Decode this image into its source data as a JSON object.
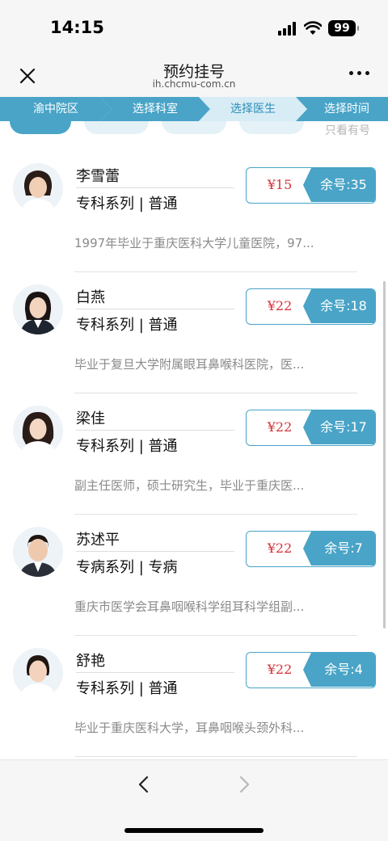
{
  "status_bar": {
    "time": "14:15",
    "battery": "99"
  },
  "header": {
    "title": "预约挂号",
    "url": "ih.chcmu-com.cn"
  },
  "steps": [
    {
      "label": "渝中院区"
    },
    {
      "label": "选择科室"
    },
    {
      "label": "选择医生"
    },
    {
      "label": "选择时间"
    }
  ],
  "filter": {
    "only_available": "只看有号"
  },
  "doctors": [
    {
      "name": "李雪蕾",
      "category": "专科系列",
      "level": "普通",
      "price": "¥15",
      "remaining": "余号:35",
      "desc": "1997年毕业于重庆医科大学儿童医院，97..."
    },
    {
      "name": "白燕",
      "category": "专科系列",
      "level": "普通",
      "price": "¥22",
      "remaining": "余号:18",
      "desc": "毕业于复旦大学附属眼耳鼻喉科医院，医..."
    },
    {
      "name": "梁佳",
      "category": "专科系列",
      "level": "普通",
      "price": "¥22",
      "remaining": "余号:17",
      "desc": "副主任医师，硕士研究生，毕业于重庆医..."
    },
    {
      "name": "苏述平",
      "category": "专病系列",
      "level": "专病",
      "price": "¥22",
      "remaining": "余号:7",
      "desc": "重庆市医学会耳鼻咽喉科学组耳科学组副..."
    },
    {
      "name": "舒艳",
      "category": "专科系列",
      "level": "普通",
      "price": "¥22",
      "remaining": "余号:4",
      "desc": "毕业于重庆医科大学，耳鼻咽喉头颈外科..."
    }
  ],
  "colors": {
    "accent": "#49a4c7",
    "price": "#d6343a",
    "step_active": "#49a4c7",
    "step_inactive": "#e4f1f7"
  },
  "icons": {
    "close": "close-icon",
    "more": "more-icon",
    "back": "chevron-left-icon",
    "forward": "chevron-right-icon"
  }
}
